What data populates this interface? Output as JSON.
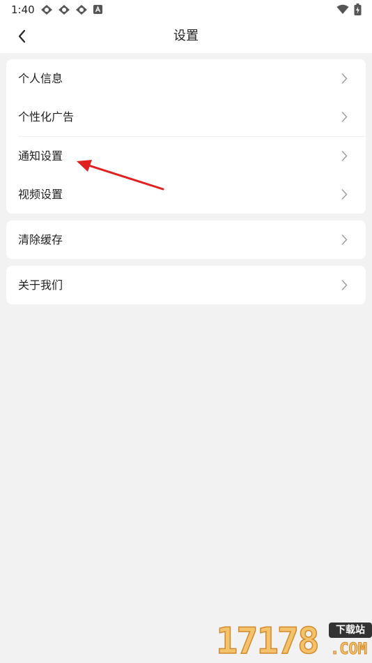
{
  "status_bar": {
    "time": "1:40",
    "icons": [
      "app-notification-icon",
      "app-notification-icon",
      "app-notification-icon",
      "a-notification-icon",
      "wifi-icon",
      "battery-charging-icon"
    ]
  },
  "header": {
    "back_icon": "chevron-left-icon",
    "title": "设置"
  },
  "groups": [
    {
      "items": [
        {
          "label": "个人信息",
          "icon": "chevron-right-icon"
        },
        {
          "label": "个性化广告",
          "icon": "chevron-right-icon"
        },
        {
          "label": "通知设置",
          "icon": "chevron-right-icon"
        },
        {
          "label": "视频设置",
          "icon": "chevron-right-icon"
        }
      ]
    },
    {
      "items": [
        {
          "label": "清除缓存",
          "icon": "chevron-right-icon"
        }
      ]
    },
    {
      "items": [
        {
          "label": "关于我们",
          "icon": "chevron-right-icon"
        }
      ]
    }
  ],
  "annotation": {
    "type": "red-arrow",
    "color": "#e02020"
  },
  "watermark": {
    "digits": "17178",
    "badge": "下载站",
    "domain": ".COM"
  },
  "colors": {
    "background": "#f2f2f2",
    "card": "#ffffff",
    "text": "#222222",
    "chevron": "#9a9a9a"
  }
}
